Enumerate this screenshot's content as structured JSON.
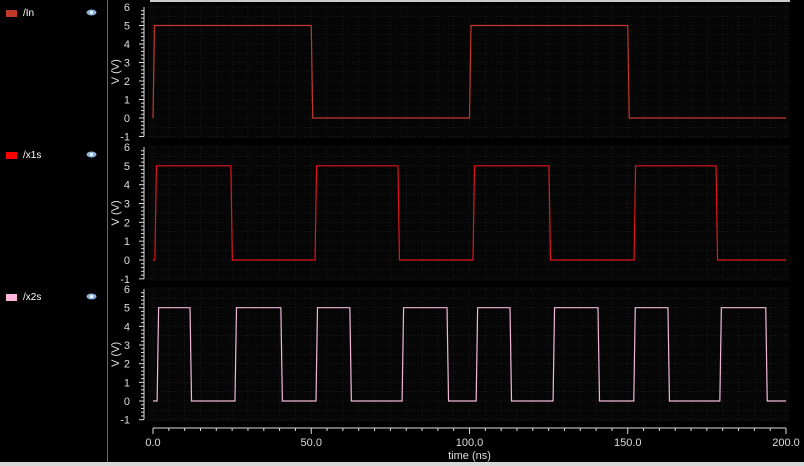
{
  "chart_data": [
    {
      "type": "line",
      "name": "/In",
      "color": "#c0392b",
      "legend_color": "#c0392b",
      "ylabel": "V (V)",
      "ylim": [
        -1,
        6
      ],
      "yticks": [
        "-1",
        "0",
        "1",
        "2",
        "3",
        "4",
        "5",
        "6"
      ],
      "edges": [
        0,
        50,
        100,
        150
      ],
      "high": 5,
      "low": 0,
      "start_high": true
    },
    {
      "type": "line",
      "name": "/x1s",
      "color": "#e0161b",
      "legend_color": "#ff0000",
      "ylabel": "V (V)",
      "ylim": [
        -1,
        6
      ],
      "yticks": [
        "-1",
        "0",
        "1",
        "2",
        "3",
        "4",
        "5",
        "6"
      ],
      "edges": [
        0.6,
        24.6,
        51.2,
        77.4,
        101.1,
        125.1,
        152,
        177.9
      ],
      "high": 5,
      "low": 0,
      "start_high": true
    },
    {
      "type": "line",
      "name": "/x2s",
      "color": "#f0b8d8",
      "legend_color": "#ffb6d9",
      "ylabel": "V (V)",
      "ylim": [
        -1,
        6
      ],
      "yticks": [
        "-1",
        "0",
        "1",
        "2",
        "3",
        "4",
        "5",
        "6"
      ],
      "edges": [
        1.3,
        11.7,
        25.9,
        40.4,
        51.5,
        62.2,
        78.7,
        92.9,
        102.1,
        112.8,
        126.4,
        140.6,
        151.9,
        162.7,
        179.1,
        193.6
      ],
      "high": 5,
      "low": 0,
      "start_high": true
    }
  ],
  "xaxis": {
    "label": "time (ns)",
    "xlim": [
      0,
      200
    ],
    "ticks": [
      "0.0",
      "50.0",
      "100.0",
      "150.0",
      "200.0"
    ]
  }
}
